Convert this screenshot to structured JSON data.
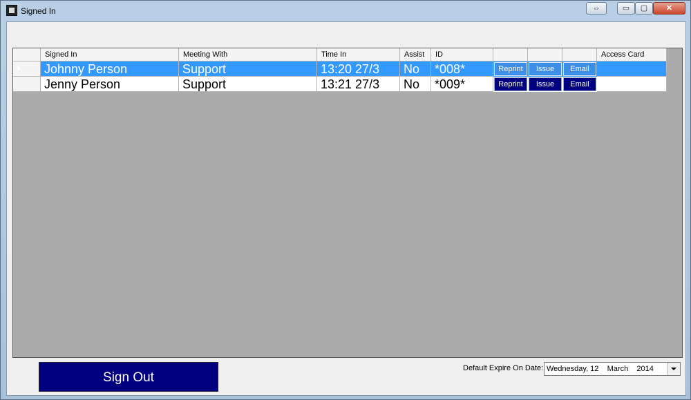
{
  "window": {
    "title": "Signed In"
  },
  "titlebar_buttons": {
    "resize": "⇔",
    "minimize": "▭",
    "maximize": "▢",
    "close": "✕"
  },
  "grid": {
    "headers": [
      "Signed In",
      "Meeting With",
      "Time In",
      "Assist",
      "ID",
      "",
      "",
      "",
      "Access Card"
    ],
    "rows": [
      {
        "signed_in": "Johnny Person",
        "meeting_with": "Support",
        "time_in": "13:20 27/3",
        "assist": "No",
        "id": "*008*",
        "reprint": "Reprint",
        "issue": "Issue",
        "email": "Email",
        "access_card": "",
        "selected": true
      },
      {
        "signed_in": "Jenny Person",
        "meeting_with": "Support",
        "time_in": "13:21 27/3",
        "assist": "No",
        "id": "*009*",
        "reprint": "Reprint",
        "issue": "Issue",
        "email": "Email",
        "access_card": "",
        "selected": false
      }
    ]
  },
  "footer": {
    "sign_out_label": "Sign Out",
    "expire_label": "Default Expire On Date:",
    "expire_date": "Wednesday, 12    March    2014"
  },
  "colors": {
    "selection": "#3399ff",
    "button_navy": "#000080",
    "grid_background": "#ababab"
  }
}
